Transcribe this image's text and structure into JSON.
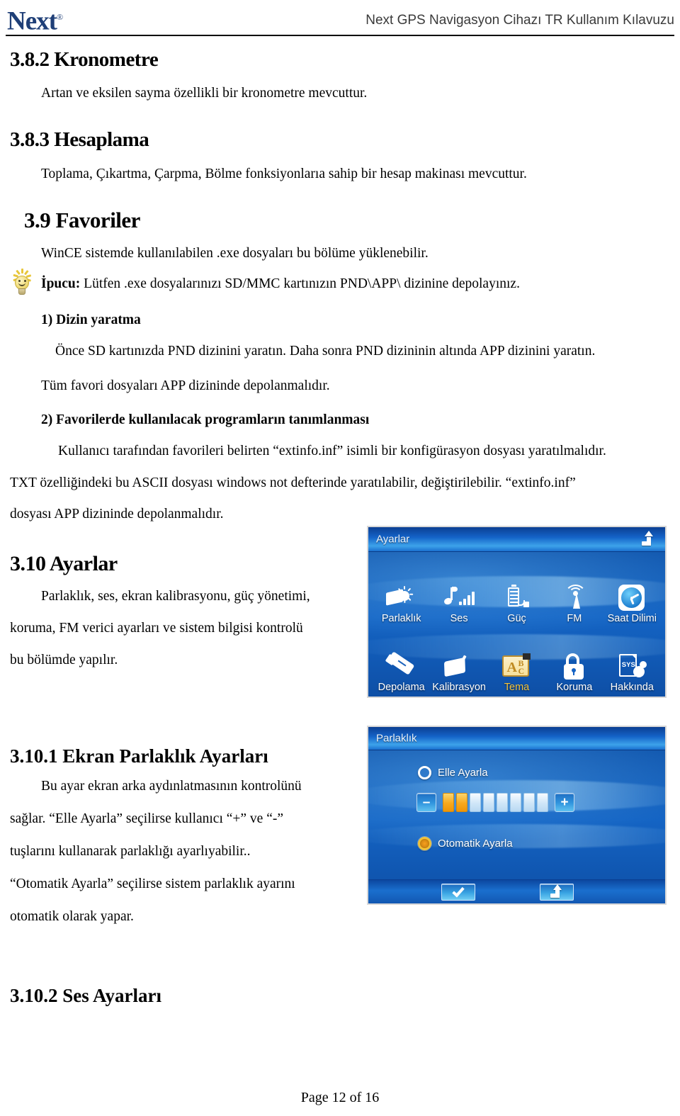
{
  "header": {
    "logo_text": "Next",
    "logo_tm": "®",
    "title": "Next GPS Navigasyon Cihazı TR Kullanım Kılavuzu"
  },
  "sections": {
    "s382_heading": "3.8.2 Kronometre",
    "s382_body": "Artan ve eksilen sayma özellikli bir kronometre mevcuttur.",
    "s383_heading": "3.8.3 Hesaplama",
    "s383_body": "Toplama, Çıkartma, Çarpma, Bölme fonksiyonlarıa sahip bir hesap makinası mevcuttur.",
    "s39_heading": "3.9 Favoriler",
    "s39_body": "WinCE sistemde kullanılabilen .exe dosyaları bu bölüme yüklenebilir.",
    "tip_label": "İpucu:",
    "tip_text": " Lütfen .exe dosyalarınızı SD/MMC kartınızın PND\\APP\\ dizinine depolayınız.",
    "step1_heading": "1) Dizin yaratma",
    "step1_body": "Önce SD kartınızda PND dizinini yaratın. Daha sonra PND dizininin altında APP dizinini yaratın.",
    "step1_body2": "Tüm favori dosyaları APP dizininde depolanmalıdır.",
    "step2_heading": "2) Favorilerde kullanılacak programların tanımlanması",
    "step2_body1": "Kullanıcı tarafından favorileri belirten “extinfo.inf” isimli bir konfigürasyon dosyası yaratılmalıdır.",
    "step2_body2": "TXT özelliğindeki bu ASCII dosyası windows not defterinde yaratılabilir, değiştirilebilir. “extinfo.inf”",
    "step2_body3": "dosyası APP dizininde depolanmalıdır.",
    "s310_heading": "3.10 Ayarlar",
    "s310_body1": "Parlaklık, ses, ekran kalibrasyonu, güç yönetimi,",
    "s310_body2": "koruma, FM verici ayarları ve sistem bilgisi kontrolü",
    "s310_body3": "bu bölümde yapılır.",
    "s3101_heading": "3.10.1 Ekran Parlaklık Ayarları",
    "s3101_body1": "Bu ayar ekran arka aydınlatmasının kontrolünü",
    "s3101_body2": "sağlar. “Elle Ayarla” seçilirse kullanıcı “+” ve “-”",
    "s3101_body3": "tuşlarını kullanarak parlaklığı ayarlıyabilir..",
    "s3101_body4": "“Otomatik Ayarla” seçilirse sistem parlaklık ayarını",
    "s3101_body5": "otomatik olarak yapar.",
    "s3102_heading": "3.10.2 Ses Ayarları"
  },
  "settings_screen": {
    "title": "Ayarlar",
    "back_icon": "return-arrow-icon",
    "items": [
      {
        "label": "Parlaklık",
        "icon": "brightness-icon",
        "accent": false
      },
      {
        "label": "Ses",
        "icon": "sound-icon",
        "accent": false
      },
      {
        "label": "Güç",
        "icon": "power-battery-icon",
        "accent": false
      },
      {
        "label": "FM",
        "icon": "fm-antenna-icon",
        "accent": false
      },
      {
        "label": "Saat Dilimi",
        "icon": "clock-icon",
        "accent": false
      },
      {
        "label": "Depolama",
        "icon": "usb-storage-icon",
        "accent": false
      },
      {
        "label": "Kalibrasyon",
        "icon": "stylus-screen-icon",
        "accent": false
      },
      {
        "label": "Tema",
        "icon": "theme-abc-icon",
        "accent": true
      },
      {
        "label": "Koruma",
        "icon": "lock-icon",
        "accent": false
      },
      {
        "label": "Hakkında",
        "icon": "sys-info-icon",
        "accent": false
      }
    ]
  },
  "brightness_screen": {
    "title": "Parlaklık",
    "manual_label": "Elle Ayarla",
    "manual_selected": false,
    "auto_label": "Otomatik Ayarla",
    "auto_selected": true,
    "minus_sign": "–",
    "plus_sign": "+",
    "level_total": 8,
    "level_value": 2,
    "ok_icon": "checkmark-icon",
    "back_icon": "return-arrow-icon"
  },
  "footer": {
    "page_text": "Page 12 of 16"
  },
  "colors": {
    "logo_blue": "#1f3f77",
    "device_blue": "#1464c4",
    "accent_gold": "#f3c23a",
    "level_on": "#f7a81d"
  }
}
